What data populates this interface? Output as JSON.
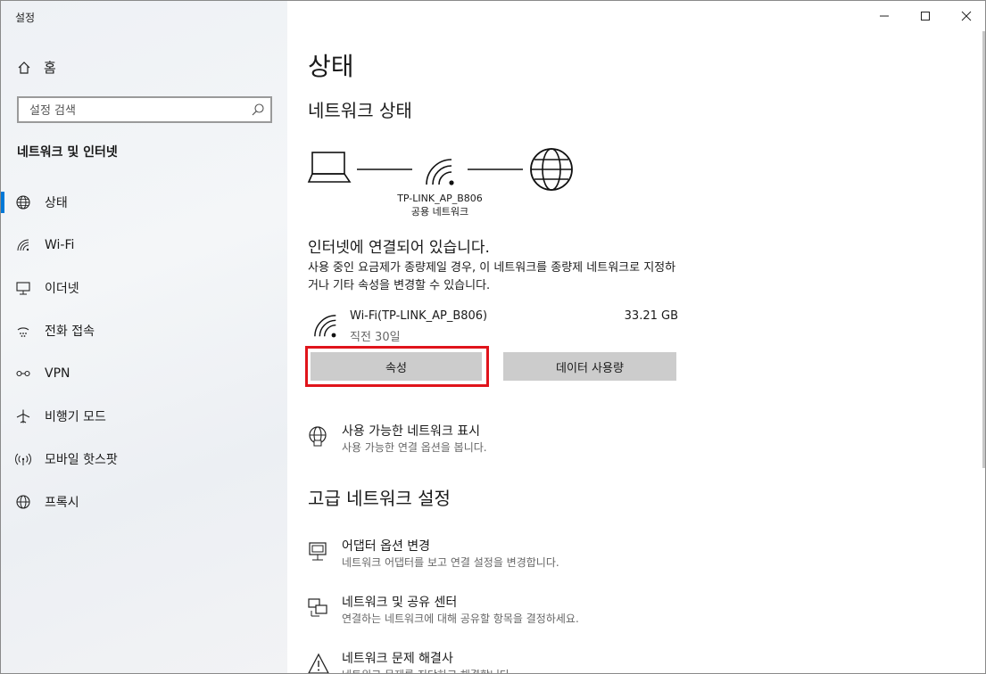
{
  "window": {
    "title": "설정"
  },
  "sidebar": {
    "home_label": "홈",
    "search_placeholder": "설정 검색",
    "section_title": "네트워크 및 인터넷",
    "items": [
      {
        "label": "상태",
        "icon": "globe-icon",
        "active": true
      },
      {
        "label": "Wi-Fi",
        "icon": "wifi-icon"
      },
      {
        "label": "이더넷",
        "icon": "ethernet-icon"
      },
      {
        "label": "전화 접속",
        "icon": "dialup-icon"
      },
      {
        "label": "VPN",
        "icon": "vpn-icon"
      },
      {
        "label": "비행기 모드",
        "icon": "airplane-icon"
      },
      {
        "label": "모바일 핫스팟",
        "icon": "hotspot-icon"
      },
      {
        "label": "프록시",
        "icon": "globe-icon"
      }
    ]
  },
  "main": {
    "page_title": "상태",
    "network_status_title": "네트워크 상태",
    "network_name": "TP-LINK_AP_B806",
    "network_type": "공용 네트워크",
    "connected_text": "인터넷에 연결되어 있습니다.",
    "description": "사용 중인 요금제가 종량제일 경우, 이 네트워크를 종량제 네트워크로 지정하거나 기타 속성을 변경할 수 있습니다.",
    "connection": {
      "name": "Wi-Fi(TP-LINK_AP_B806)",
      "time": "직전 30일",
      "usage": "33.21 GB"
    },
    "buttons": {
      "properties": "속성",
      "data_usage": "데이터 사용량"
    },
    "show_networks": {
      "title": "사용 가능한 네트워크 표시",
      "subtitle": "사용 가능한 연결 옵션을 봅니다."
    },
    "advanced_title": "고급 네트워크 설정",
    "adapter_options": {
      "title": "어댑터 옵션 변경",
      "subtitle": "네트워크 어댑터를 보고 연결 설정을 변경합니다."
    },
    "sharing_center": {
      "title": "네트워크 및 공유 센터",
      "subtitle": "연결하는 네트워크에 대해 공유할 항목을 결정하세요."
    },
    "troubleshooter": {
      "title": "네트워크 문제 해결사",
      "subtitle": "네트워크 문제를 진단하고 해결합니다."
    }
  },
  "colors": {
    "accent": "#0078d7",
    "highlight_border": "#e0141b",
    "button_bg": "#cccccc"
  }
}
